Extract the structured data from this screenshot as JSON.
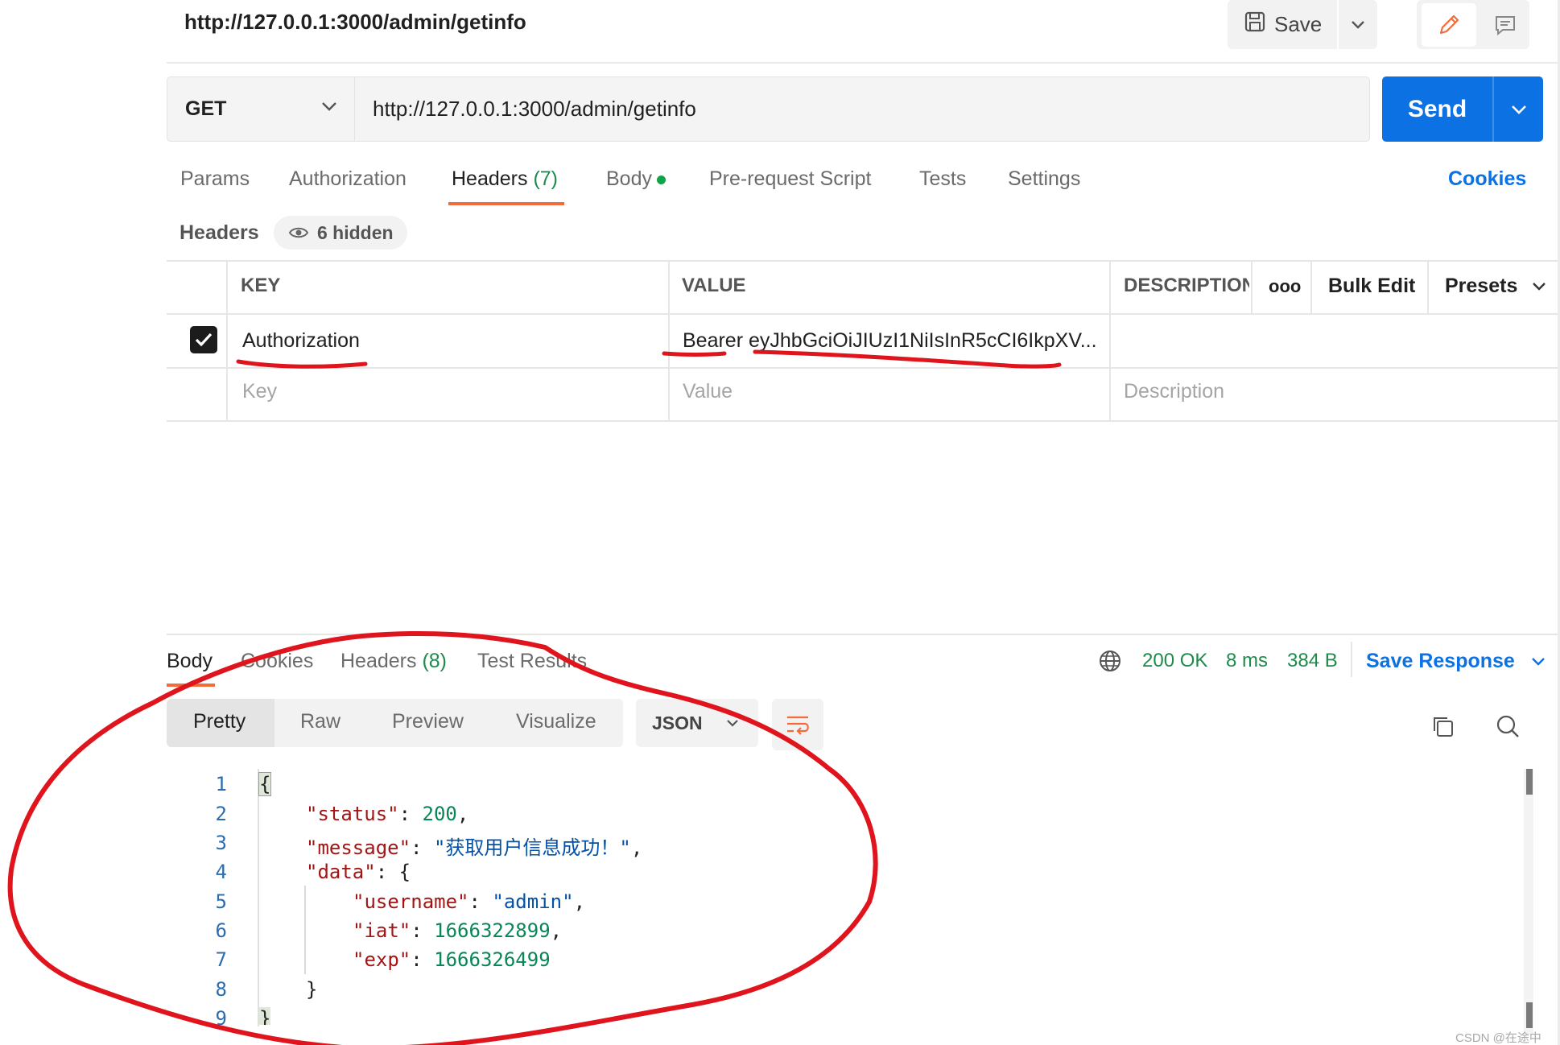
{
  "header": {
    "title": "http://127.0.0.1:3000/admin/getinfo",
    "save_label": "Save"
  },
  "request": {
    "method": "GET",
    "url": "http://127.0.0.1:3000/admin/getinfo",
    "send_label": "Send"
  },
  "tabs": {
    "params": "Params",
    "authorization": "Authorization",
    "headers": "Headers",
    "headers_count": "(7)",
    "body": "Body",
    "prerequest": "Pre-request Script",
    "tests": "Tests",
    "settings": "Settings",
    "cookies": "Cookies"
  },
  "headers_panel": {
    "label": "Headers",
    "hidden": "6 hidden"
  },
  "table": {
    "col_key": "KEY",
    "col_value": "VALUE",
    "col_description": "DESCRIPTION",
    "more": "ooo",
    "bulk_edit": "Bulk Edit",
    "presets": "Presets",
    "rows": [
      {
        "key": "Authorization",
        "value": "Bearer eyJhbGciOiJIUzI1NiIsInR5cCI6IkpXV..."
      }
    ],
    "placeholder_key": "Key",
    "placeholder_value": "Value",
    "placeholder_description": "Description"
  },
  "response": {
    "tabs": {
      "body": "Body",
      "cookies": "Cookies",
      "headers": "Headers",
      "headers_count": "(8)",
      "test_results": "Test Results"
    },
    "status": "200 OK",
    "time": "8 ms",
    "size": "384 B",
    "save_response": "Save Response",
    "views": [
      "Pretty",
      "Raw",
      "Preview",
      "Visualize"
    ],
    "format": "JSON",
    "line_numbers": [
      "1",
      "2",
      "3",
      "4",
      "5",
      "6",
      "7",
      "8",
      "9"
    ],
    "code": {
      "open": "{",
      "k_status": "\"status\"",
      "v_status": "200",
      "k_message": "\"message\"",
      "v_message": "\"获取用户信息成功！\"",
      "k_data": "\"data\"",
      "k_username": "\"username\"",
      "v_username": "\"admin\"",
      "k_iat": "\"iat\"",
      "v_iat": "1666322899",
      "k_exp": "\"exp\"",
      "v_exp": "1666326499",
      "inner_close": "}",
      "close": "}"
    }
  },
  "watermark": "CSDN @在途中",
  "colors": {
    "accent": "#0c72e3",
    "tab_underline": "#f26b3a",
    "status_green": "#1f8a4c",
    "annotation_red": "#e0141c"
  }
}
